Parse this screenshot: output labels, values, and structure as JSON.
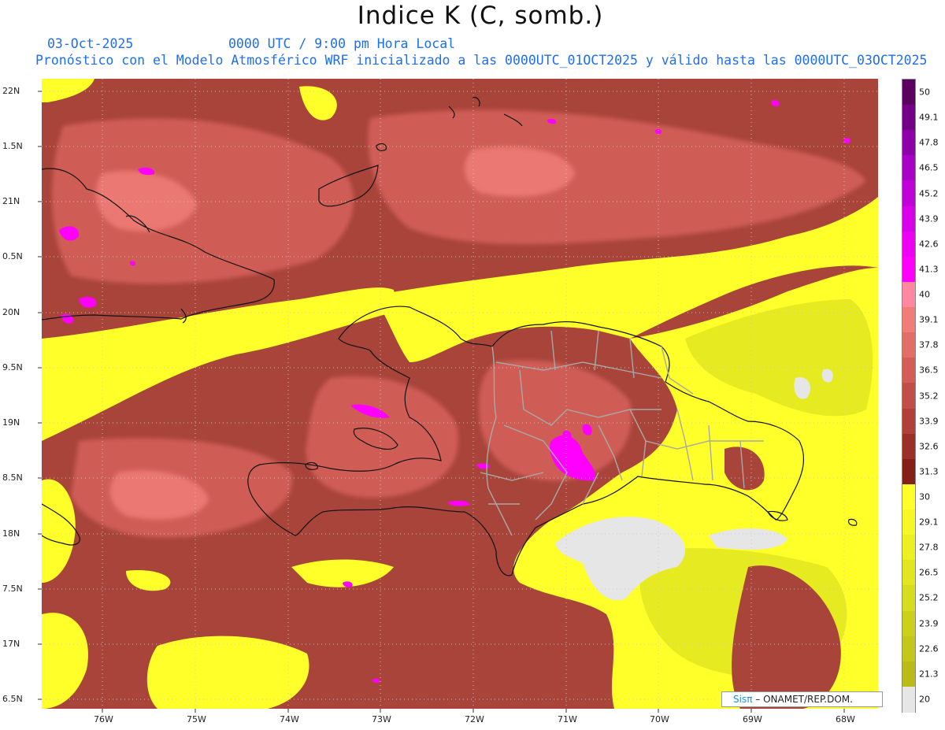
{
  "header": {
    "title": "Indice K (C, somb.)",
    "date": "03-Oct-2025",
    "time": "0000 UTC / 9:00 pm Hora Local",
    "description": "Pronóstico con el Modelo Atmosférico WRF inicializado a las 0000UTC_01OCT2025 y válido hasta las  0000UTC_03OCT2025"
  },
  "map": {
    "region": "Hispaniola / Cuba / Bahamas",
    "lat_labels": [
      "22N",
      "1.5N",
      "21N",
      "0.5N",
      "20N",
      "9.5N",
      "19N",
      "8.5N",
      "18N",
      "7.5N",
      "17N",
      "6.5N"
    ],
    "lon_labels": [
      "76W",
      "75W",
      "74W",
      "73W",
      "72W",
      "71W",
      "70W",
      "69W",
      "68W"
    ]
  },
  "colorbar": {
    "levels": [
      {
        "label": "50",
        "color": "#5c0060"
      },
      {
        "label": "49.1",
        "color": "#750088"
      },
      {
        "label": "47.8",
        "color": "#8e00a8"
      },
      {
        "label": "46.5",
        "color": "#a800c4"
      },
      {
        "label": "45.2",
        "color": "#c000d8"
      },
      {
        "label": "43.9",
        "color": "#d800e8"
      },
      {
        "label": "42.6",
        "color": "#ee00f4"
      },
      {
        "label": "41.3",
        "color": "#ff00ff"
      },
      {
        "label": "40",
        "color": "#ff88a0"
      },
      {
        "label": "39.1",
        "color": "#f07d78"
      },
      {
        "label": "37.8",
        "color": "#e36e66"
      },
      {
        "label": "36.5",
        "color": "#d45e56"
      },
      {
        "label": "35.2",
        "color": "#c24f47"
      },
      {
        "label": "33.9",
        "color": "#b04038"
      },
      {
        "label": "32.6",
        "color": "#9a3028"
      },
      {
        "label": "31.3",
        "color": "#842018"
      },
      {
        "label": "30",
        "color": "#ffff2a"
      },
      {
        "label": "29.1",
        "color": "#f7f726"
      },
      {
        "label": "27.8",
        "color": "#ecf022"
      },
      {
        "label": "26.5",
        "color": "#e2e620"
      },
      {
        "label": "25.2",
        "color": "#d6dc1e"
      },
      {
        "label": "23.9",
        "color": "#cccf1c"
      },
      {
        "label": "22.6",
        "color": "#c4c61a"
      },
      {
        "label": "21.3",
        "color": "#bbbb18"
      },
      {
        "label": "20",
        "color": "#e6e6e6"
      }
    ]
  },
  "credit": {
    "brand": "Sisπ",
    "text": "– ONAMET/REP.DOM."
  }
}
